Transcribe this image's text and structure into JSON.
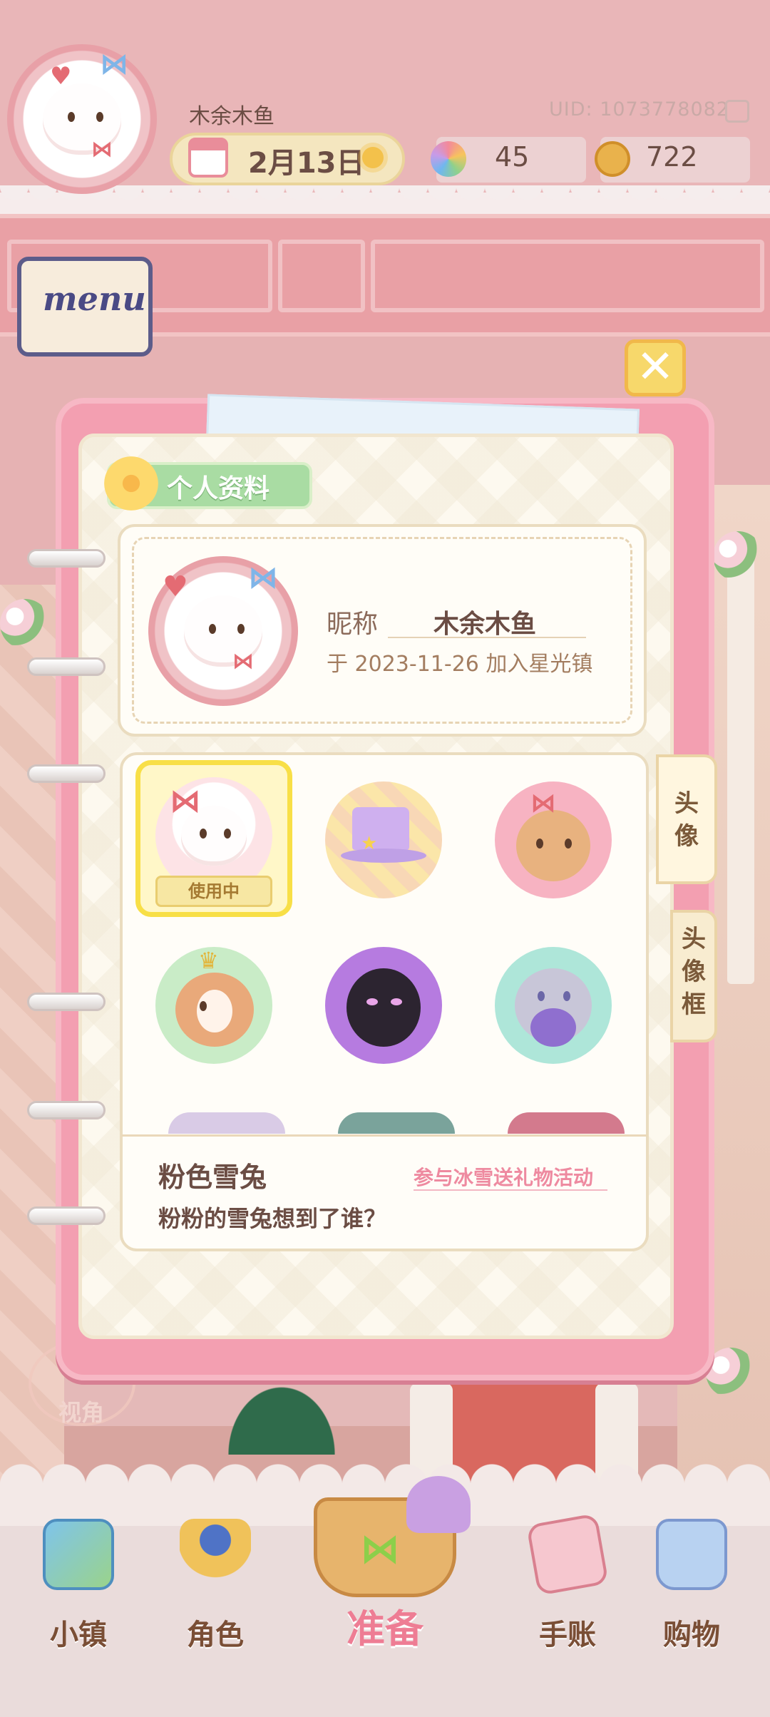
{
  "header": {
    "username": "木余木鱼",
    "uid": "UID: 1073778082",
    "date": "2月13日",
    "petals": "45",
    "coins": "722",
    "menu_label": "menu"
  },
  "profile": {
    "section_title": "个人资料",
    "nickname_label": "昵称",
    "nickname_value": "木余木鱼",
    "join_text": "于 2023-11-26 加入星光镇"
  },
  "avatar_grid": {
    "in_use_badge": "使用中",
    "items": [
      "pink-bunny",
      "purple-top-hat",
      "bear-girl",
      "puppy",
      "black-cat",
      "grey-cat"
    ]
  },
  "tabs": {
    "avatar": "头\n像",
    "avatar_frame": "头\n像\n框"
  },
  "selected_item": {
    "name": "粉色雪兔",
    "source": "参与冰雪送礼物活动",
    "description": "粉粉的雪兔想到了谁？"
  },
  "nav": {
    "town": "小镇",
    "character": "角色",
    "prepare": "准备",
    "journal": "手账",
    "shop": "购物"
  },
  "background": {
    "view_label": "视角"
  },
  "colors": {
    "dialog_frame": "#f39fb1",
    "accent_yellow": "#f8df47",
    "title_green": "#a9dca3",
    "event_pink": "#ee8aa0"
  }
}
